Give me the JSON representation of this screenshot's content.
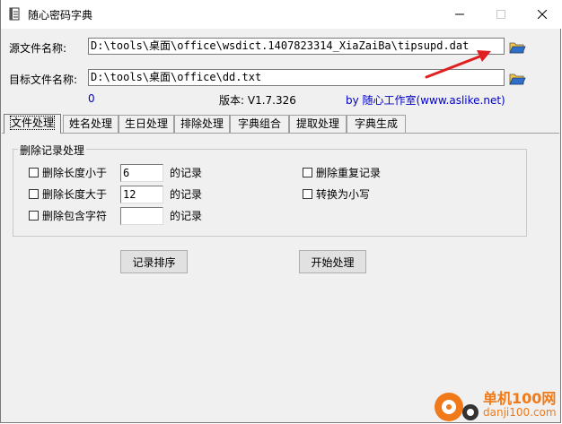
{
  "window": {
    "title": "随心密码字典"
  },
  "source": {
    "label": "源文件名称:",
    "value": "D:\\tools\\桌面\\office\\wsdict.1407823314_XiaZaiBa\\tipsupd.dat"
  },
  "target": {
    "label": "目标文件名称:",
    "value": "D:\\tools\\桌面\\office\\dd.txt"
  },
  "status": {
    "count": "0",
    "version": "版本: V1.7.326",
    "credit": "by 随心工作室(www.aslike.net)"
  },
  "tabs": [
    "文件处理",
    "姓名处理",
    "生日处理",
    "排除处理",
    "字典组合",
    "提取处理",
    "字典生成"
  ],
  "group": {
    "title": "删除记录处理",
    "opt_min_len": "删除长度小于",
    "min_len_value": "6",
    "opt_max_len": "删除长度大于",
    "max_len_value": "12",
    "opt_contains": "删除包含字符",
    "contains_value": "",
    "suffix": "的记录",
    "opt_dedupe": "删除重复记录",
    "opt_lowercase": "转换为小写"
  },
  "buttons": {
    "sort": "记录排序",
    "start": "开始处理"
  },
  "watermark": {
    "cn": "单机100网",
    "url": "danji100.com"
  },
  "colors": {
    "link_blue": "#0000c8",
    "arrow_red": "#e02020",
    "watermark_orange": "#f07a1a"
  }
}
